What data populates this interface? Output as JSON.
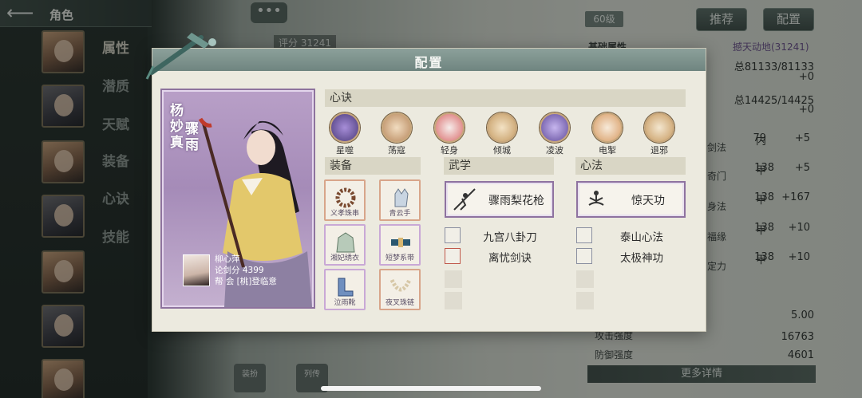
{
  "header": {
    "title": "角色",
    "more_button": "•••"
  },
  "sidebar": {
    "tabs": [
      "属性",
      "潜质",
      "天赋",
      "装备",
      "心诀",
      "技能"
    ]
  },
  "background": {
    "score": "评分 31241",
    "level": "60级",
    "recommend_btn": "推荐",
    "config_btn": "配置",
    "basic_title": "基础属性",
    "power_link": "撼天动地(31241)",
    "hp": "总81133/81133",
    "hp_delta": "+0",
    "mp": "总14425/14425",
    "mp_delta": "+0",
    "stats": [
      {
        "label": "剑法",
        "grade": "内",
        "val": "79",
        "delta": "+5"
      },
      {
        "label": "奇门",
        "grade": "甲",
        "val": "138",
        "delta": "+5"
      },
      {
        "label": "身法",
        "grade": "甲",
        "val": "138",
        "delta": "+167"
      },
      {
        "label": "福缘",
        "grade": "甲",
        "val": "138",
        "delta": "+10"
      },
      {
        "label": "定力",
        "grade": "甲",
        "val": "138",
        "delta": "+10"
      }
    ],
    "attr_value_1": "5.00",
    "attack_label": "攻击强度",
    "attack_val": "16763",
    "defense_label": "防御强度",
    "defense_val": "4601",
    "more_details": "更多详情",
    "bottom_tabs": [
      "装扮",
      "列传"
    ]
  },
  "modal": {
    "title": "配置",
    "character": {
      "name": "杨妙真",
      "nickname": "骤雨",
      "player": "柳心萍",
      "score": "论剑分 4399",
      "guild": "帮  会 [桃]登临意"
    },
    "xinjue_title": "心诀",
    "xinjue": [
      "星噬",
      "荡寇",
      "轻身",
      "倾城",
      "凌波",
      "电掣",
      "退邪"
    ],
    "equip_title": "装备",
    "equipment": [
      "义孝珠串",
      "青云手",
      "湘妃绣衣",
      "短梦系带",
      "泣雨靴",
      "夜叉珠链"
    ],
    "wuxue_title": "武学",
    "wuxue_main": "骤雨梨花枪",
    "wuxue_list": [
      "九宫八卦刀",
      "离忧剑诀"
    ],
    "xinfa_title": "心法",
    "xinfa_main": "惊天功",
    "xinfa_list": [
      "泰山心法",
      "太极神功"
    ]
  },
  "colors": {
    "accent": "#8e72a0",
    "header": "#7f948e",
    "panel": "#eceadf"
  }
}
